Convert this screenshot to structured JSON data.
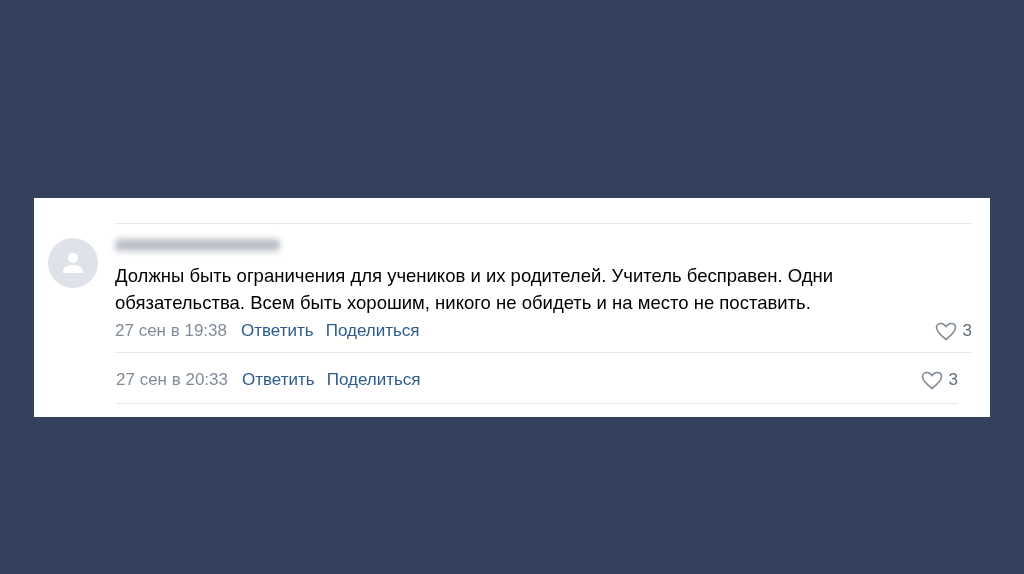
{
  "comments": [
    {
      "kind": "full",
      "text": "Должны быть ограничения для учеников и их родителей. Учитель бесправен. Одни обязательства. Всем быть хорошим, никого не обидеть и на место не поставить.",
      "date": "27 сен в 19:38",
      "actions": [
        "Ответить",
        "Поделиться"
      ],
      "likes": "3"
    },
    {
      "kind": "partial",
      "date": "27 сен в 20:33",
      "actions": [
        "Ответить",
        "Поделиться"
      ],
      "likes": "3"
    }
  ]
}
